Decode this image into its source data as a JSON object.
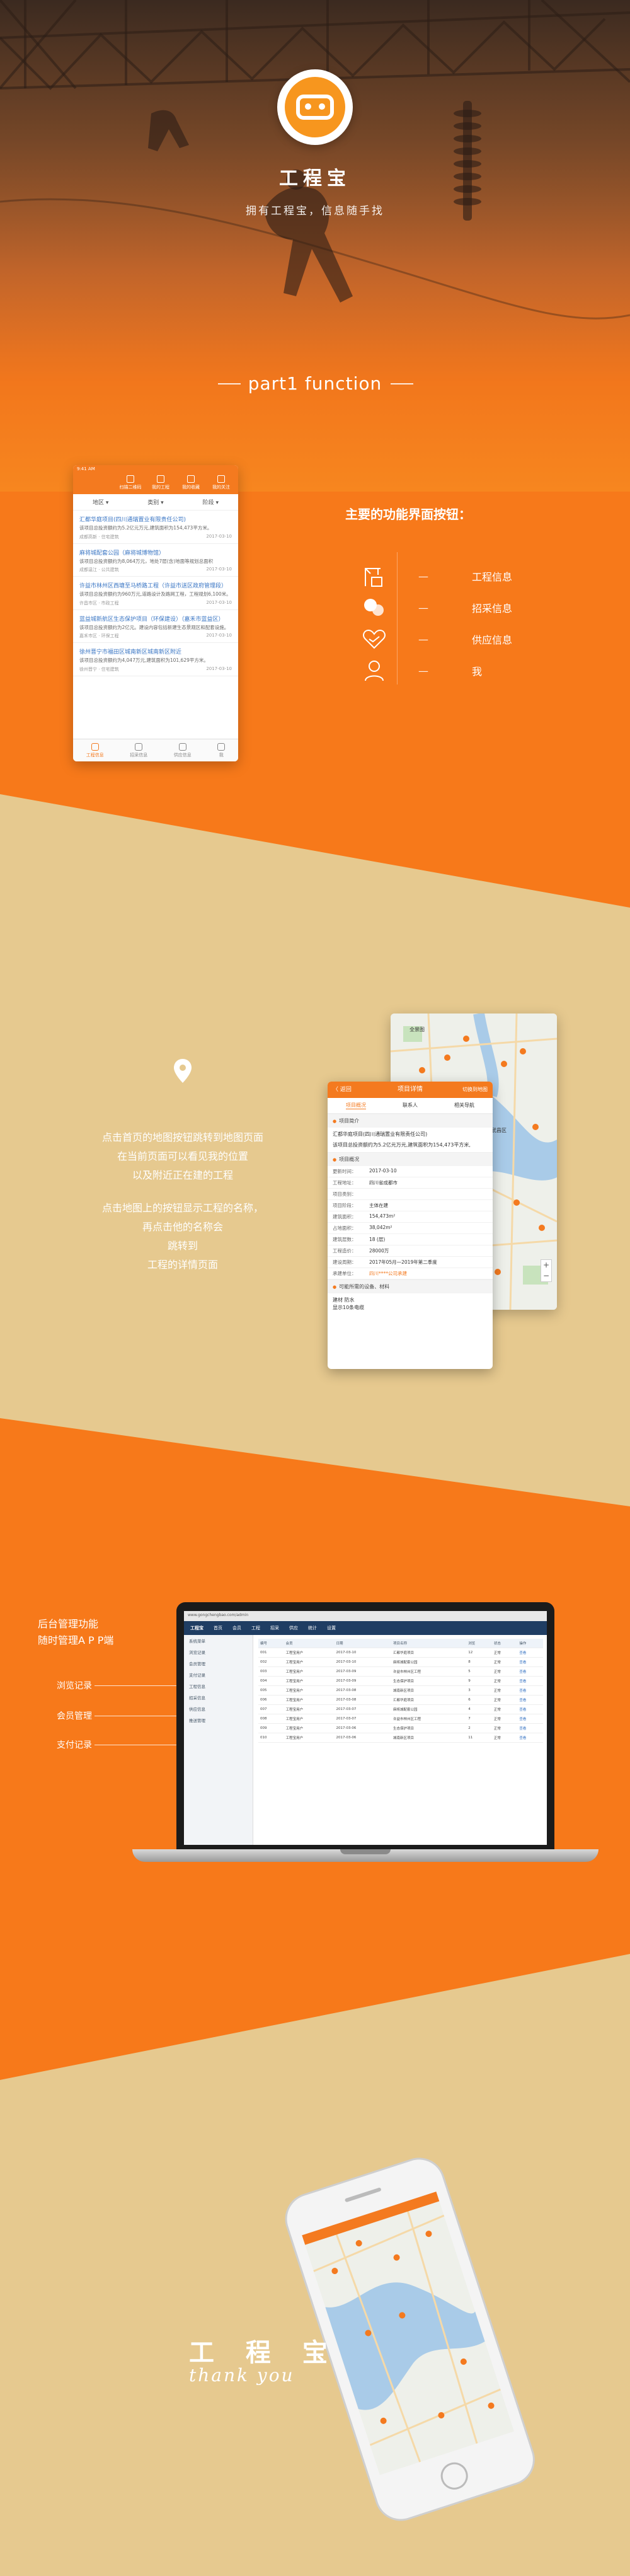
{
  "hero": {
    "app_name": "工程宝",
    "slogan": "拥有工程宝，信息随手找",
    "part_title": "part1 function"
  },
  "function_section": {
    "heading": "主要的功能界面按钮：",
    "items": [
      {
        "label": "工程信息",
        "icon": "building-crane-icon"
      },
      {
        "label": "招采信息",
        "icon": "chat-bubbles-icon"
      },
      {
        "label": "供应信息",
        "icon": "handshake-heart-icon"
      },
      {
        "label": "我",
        "icon": "user-icon"
      }
    ],
    "dash": "—"
  },
  "phone_list": {
    "status": "9:41 AM",
    "top_buttons": [
      "扫描二维码",
      "我的工程",
      "我的收藏",
      "我的关注"
    ],
    "filters": [
      "地区 ▾",
      "类别 ▾",
      "阶段 ▾"
    ],
    "items": [
      {
        "title": "汇都华庭项目(四川通瑞置业有限责任公司)",
        "desc": "该项目总投资额约为5.2亿元万元,建筑面积为154,473平方米。",
        "meta_left": "成都高新 · 住宅建筑",
        "meta_right": "2017-03-10"
      },
      {
        "title": "麻将城配套公园（麻将城博物馆）",
        "desc": "该项目总投资额约为8,064万元，地处7层(含)地面等规划总面积",
        "meta_left": "成都温江 · 公共建筑",
        "meta_right": "2017-03-10"
      },
      {
        "title": "许益市林州区西塘至马桥路工程（许益市送区政府管理段）",
        "desc": "该项目总投资额约为960万元,道路设计及路网工程，工程规划6,100米。",
        "meta_left": "许昌市区 · 市政工程",
        "meta_right": "2017-03-10"
      },
      {
        "title": "蓝益城新航区生态保护项目（环保建设）（嘉禾市蓝益区）",
        "desc": "该项目总投资额约为2亿元。建设内容包括新建生态景观区和配套设施。",
        "meta_left": "嘉禾市区 · 环保工程",
        "meta_right": "2017-03-10"
      },
      {
        "title": "徐州晋宁市福田区城南新区城南新区附近",
        "desc": "该项目总投资额约为4,047万元,建筑面积为101,629平方米。",
        "meta_left": "徐州晋宁 · 住宅建筑",
        "meta_right": "2017-03-10"
      }
    ],
    "tabs": [
      "工程信息",
      "招采信息",
      "供应信息",
      "我"
    ]
  },
  "map_section": {
    "lines": [
      "点击首页的地图按钮跳转到地图页面",
      "在当前页面可以看见我的位置",
      "以及附近正在建的工程",
      "",
      "点击地图上的按钮显示工程的名称，",
      "再点击他的名称会",
      "跳转到",
      "工程的详情页面"
    ]
  },
  "detail_screen": {
    "back": "〈 返回",
    "title": "项目详情",
    "switch": "切换到地图",
    "tabs": [
      "项目概况",
      "联系人",
      "相关导航"
    ],
    "section1": "项目简介",
    "intro": "汇都华庭项目(四川通瑞置业有限责任公司)",
    "intro2": "该项目总投资额约为5.2亿元万元,建筑面积为154,473平方米,",
    "section2": "项目概况",
    "rows": [
      {
        "k": "更新时间：",
        "v": "2017-03-10"
      },
      {
        "k": "工程地址：",
        "v": "四川省成都市"
      },
      {
        "k": "项目类别：",
        "v": ""
      },
      {
        "k": "项目阶段：",
        "v": "主体在建"
      },
      {
        "k": "建筑面积：",
        "v": "154,473m²"
      },
      {
        "k": "占地面积：",
        "v": "38,042m²"
      },
      {
        "k": "建筑层数：",
        "v": "18 (层)"
      },
      {
        "k": "工程造价：",
        "v": "28000万"
      },
      {
        "k": "建设周期：",
        "v": "2017年05月—2019年第二季度"
      },
      {
        "k": "承建单位：",
        "v": "四川****公司承建"
      }
    ],
    "section3": "可能所需的设备、材料",
    "materials": "建材 防水\n显示10条电缆"
  },
  "map_screen": {
    "label_top": "全景图",
    "label_left": "武昌区",
    "label_center": "汉阳",
    "zoom_plus": "+",
    "zoom_minus": "−"
  },
  "admin": {
    "intro_line1": "后台管理功能",
    "intro_line2": "随时管理A P P端",
    "items": [
      "浏览记录",
      "会员管理",
      "支付记录"
    ],
    "window_title": "工程宝",
    "url": "www.gongchengbao.com/admin",
    "nav": [
      "首页",
      "会员",
      "工程",
      "招采",
      "供应",
      "统计",
      "设置"
    ],
    "sidebar": [
      "系统菜单",
      "浏览记录",
      "会员管理",
      "支付记录",
      "工程信息",
      "招采信息",
      "供应信息",
      "推送管理"
    ],
    "table_head": [
      "编号",
      "会员",
      "日期",
      "项目名称",
      "浏览",
      "状态",
      "操作"
    ],
    "table_rows": [
      [
        "001",
        "工程宝用户",
        "2017-03-10",
        "汇都华庭项目",
        "12",
        "正常",
        "查看"
      ],
      [
        "002",
        "工程宝用户",
        "2017-03-10",
        "麻将城配套公园",
        "8",
        "正常",
        "查看"
      ],
      [
        "003",
        "工程宝用户",
        "2017-03-09",
        "许益市林州区工程",
        "5",
        "正常",
        "查看"
      ],
      [
        "004",
        "工程宝用户",
        "2017-03-09",
        "生态保护项目",
        "9",
        "正常",
        "查看"
      ],
      [
        "005",
        "工程宝用户",
        "2017-03-08",
        "城南新区项目",
        "3",
        "正常",
        "查看"
      ],
      [
        "006",
        "工程宝用户",
        "2017-03-08",
        "汇都华庭项目",
        "6",
        "正常",
        "查看"
      ],
      [
        "007",
        "工程宝用户",
        "2017-03-07",
        "麻将城配套公园",
        "4",
        "正常",
        "查看"
      ],
      [
        "008",
        "工程宝用户",
        "2017-03-07",
        "许益市林州区工程",
        "7",
        "正常",
        "查看"
      ],
      [
        "009",
        "工程宝用户",
        "2017-03-06",
        "生态保护项目",
        "2",
        "正常",
        "查看"
      ],
      [
        "010",
        "工程宝用户",
        "2017-03-06",
        "城南新区项目",
        "11",
        "正常",
        "查看"
      ]
    ]
  },
  "thanks": {
    "cn": "工 程 宝",
    "en": "thank you"
  },
  "colors": {
    "orange": "#f7791a",
    "beige": "#e6c98f",
    "accent": "#f47a1f"
  }
}
